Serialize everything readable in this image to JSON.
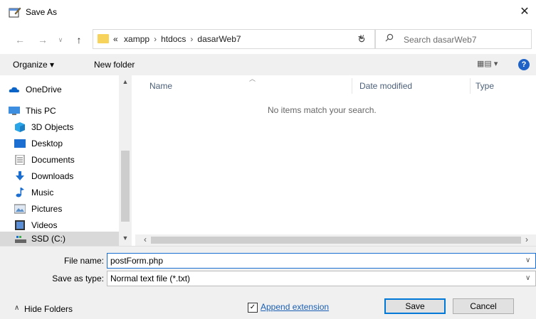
{
  "window": {
    "title": "Save As",
    "close_label": "✕"
  },
  "address": {
    "prefix": "«",
    "segments": [
      "xampp",
      "htdocs",
      "dasarWeb7"
    ],
    "search_placeholder": "Search dasarWeb7"
  },
  "toolbar": {
    "organize_label": "Organize ▾",
    "new_folder_label": "New folder",
    "help_label": "?"
  },
  "nav": {
    "items": [
      {
        "label": "OneDrive",
        "icon": "cloud-icon"
      },
      {
        "label": "This PC",
        "icon": "computer-icon"
      },
      {
        "label": "3D Objects",
        "icon": "cube-icon"
      },
      {
        "label": "Desktop",
        "icon": "desktop-icon"
      },
      {
        "label": "Documents",
        "icon": "documents-icon"
      },
      {
        "label": "Downloads",
        "icon": "download-icon"
      },
      {
        "label": "Music",
        "icon": "music-icon"
      },
      {
        "label": "Pictures",
        "icon": "pictures-icon"
      },
      {
        "label": "Videos",
        "icon": "videos-icon"
      },
      {
        "label": "SSD (C:)",
        "icon": "drive-icon"
      }
    ]
  },
  "filelist": {
    "columns": [
      "Name",
      "Date modified",
      "Type"
    ],
    "empty_message": "No items match your search."
  },
  "form": {
    "file_name_label": "File name:",
    "file_name_value": "postForm.php",
    "save_as_type_label": "Save as type:",
    "save_as_type_value": "Normal text file (*.txt)",
    "append_extension_label": "Append extension",
    "append_extension_checked": true
  },
  "footer": {
    "hide_folders_label": "Hide Folders",
    "save_label": "Save",
    "cancel_label": "Cancel"
  },
  "colors": {
    "accent": "#0078d7",
    "folder": "#f7d35b",
    "help": "#1e62c8"
  }
}
